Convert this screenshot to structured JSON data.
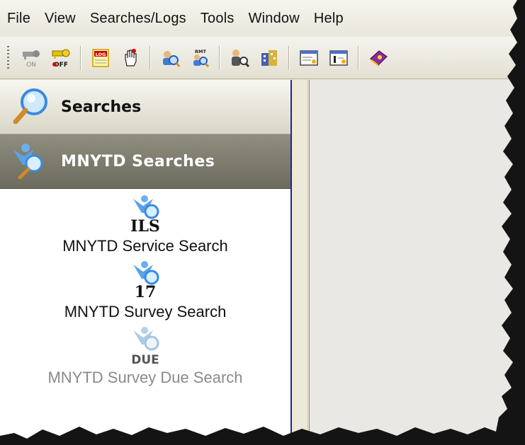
{
  "menubar": {
    "items": [
      "File",
      "View",
      "Searches/Logs",
      "Tools",
      "Window",
      "Help"
    ]
  },
  "toolbar": {
    "buttons": [
      {
        "icon": "key-on-icon",
        "text": "ON",
        "enabled": false
      },
      {
        "icon": "key-off-icon",
        "text": "OFF",
        "enabled": true
      },
      {
        "icon": "log-icon",
        "text": "LOG",
        "enabled": true
      },
      {
        "icon": "hand-cursor-icon",
        "enabled": true
      },
      {
        "icon": "search-people-icon",
        "enabled": true
      },
      {
        "icon": "search-rmt-icon",
        "text": "RMT",
        "enabled": true
      },
      {
        "icon": "person-search-icon",
        "enabled": true
      },
      {
        "icon": "building-icon",
        "enabled": true
      },
      {
        "icon": "report-icon",
        "enabled": true
      },
      {
        "icon": "report-edit-icon",
        "enabled": true
      },
      {
        "icon": "book-icon",
        "enabled": true
      }
    ]
  },
  "sidebar": {
    "searches_header": "Searches",
    "group_header": "MNYTD Searches",
    "items": [
      {
        "tag": "ILS",
        "label": "MNYTD Service Search",
        "enabled": true
      },
      {
        "tag": "17",
        "label": "MNYTD Survey Search",
        "enabled": true
      },
      {
        "tag": "DUE",
        "label": "MNYTD Survey Due Search",
        "enabled": false
      }
    ]
  },
  "colors": {
    "menubar_bg": "#ece9d8",
    "group_header_bg": "#7d7c6e",
    "panel_border": "#1d2a85",
    "disabled_text": "#8a8a8a"
  }
}
